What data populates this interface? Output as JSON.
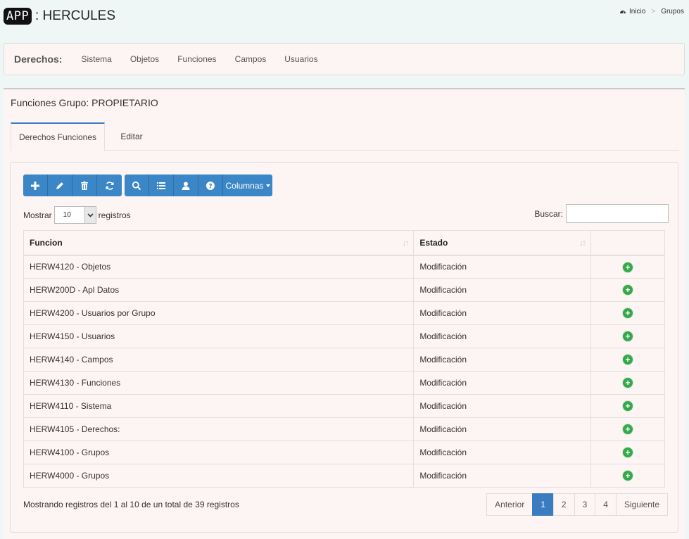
{
  "header": {
    "app_badge": "APP",
    "app_title": ": HERCULES",
    "breadcrumb": {
      "home": "Inicio",
      "current": "Grupos",
      "separator": ">"
    }
  },
  "nav": {
    "title": "Derechos:",
    "items": [
      "Sistema",
      "Objetos",
      "Funciones",
      "Campos",
      "Usuarios"
    ]
  },
  "panel": {
    "title": "Funciones Grupo: PROPIETARIO",
    "tabs": [
      "Derechos Funciones",
      "Editar"
    ]
  },
  "toolbar": {
    "buttons": [
      "plus-icon",
      "pencil-icon",
      "trash-icon",
      "refresh-icon",
      "search-icon",
      "list-icon",
      "user-icon",
      "help-icon"
    ],
    "columns_label": "Columnas"
  },
  "length": {
    "label_before": "Mostrar",
    "value": "10",
    "label_after": "registros"
  },
  "search": {
    "label": "Buscar:",
    "value": ""
  },
  "table": {
    "headers": [
      "Funcion",
      "Estado",
      ""
    ],
    "rows": [
      [
        "HERW4120 - Objetos",
        "Modificación"
      ],
      [
        "HERW200D - Apl Datos",
        "Modificación"
      ],
      [
        "HERW4200 - Usuarios por Grupo",
        "Modificación"
      ],
      [
        "HERW4150 - Usuarios",
        "Modificación"
      ],
      [
        "HERW4140 - Campos",
        "Modificación"
      ],
      [
        "HERW4130 - Funciones",
        "Modificación"
      ],
      [
        "HERW4110 - Sistema",
        "Modificación"
      ],
      [
        "HERW4105 - Derechos:",
        "Modificación"
      ],
      [
        "HERW4100 - Grupos",
        "Modificación"
      ],
      [
        "HERW4000 - Grupos",
        "Modificación"
      ]
    ]
  },
  "footer": {
    "info": "Mostrando registros del 1 al 10 de un total de 39 registros",
    "pagination": {
      "prev": "Anterior",
      "pages": [
        "1",
        "2",
        "3",
        "4"
      ],
      "active": "1",
      "next": "Siguiente"
    }
  },
  "colors": {
    "primary": "#3b86c6",
    "panel_bg": "#fdf4f4",
    "page_bg": "#eef7f6",
    "add_green": "#35a84a"
  }
}
